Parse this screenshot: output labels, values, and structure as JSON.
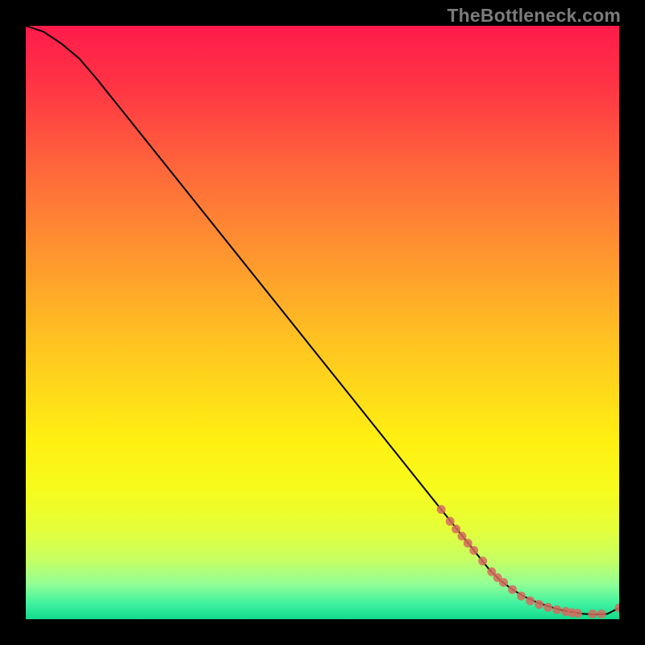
{
  "watermark": "TheBottleneck.com",
  "chart_data": {
    "type": "line",
    "title": "",
    "xlabel": "",
    "ylabel": "",
    "xlim": [
      0,
      100
    ],
    "ylim": [
      0,
      100
    ],
    "grid": false,
    "legend": false,
    "background_gradient_stops": [
      {
        "offset": 0.0,
        "color": "#ff1b4b"
      },
      {
        "offset": 0.1,
        "color": "#ff3445"
      },
      {
        "offset": 0.25,
        "color": "#ff6a3a"
      },
      {
        "offset": 0.4,
        "color": "#ff9a2e"
      },
      {
        "offset": 0.55,
        "color": "#ffc81f"
      },
      {
        "offset": 0.7,
        "color": "#fff012"
      },
      {
        "offset": 0.78,
        "color": "#f7fb1c"
      },
      {
        "offset": 0.85,
        "color": "#e4ff3a"
      },
      {
        "offset": 0.9,
        "color": "#c6ff63"
      },
      {
        "offset": 0.94,
        "color": "#93ff95"
      },
      {
        "offset": 0.975,
        "color": "#3cf1a0"
      },
      {
        "offset": 1.0,
        "color": "#14d98b"
      }
    ],
    "series": [
      {
        "name": "bottleneck-curve",
        "color": "#000000",
        "x": [
          0,
          3,
          6,
          9,
          12,
          16,
          24,
          32,
          40,
          48,
          56,
          64,
          70,
          74,
          78,
          80,
          82,
          84,
          86,
          88,
          90,
          92,
          94,
          96,
          98,
          100
        ],
        "values": [
          100,
          99,
          97,
          94.5,
          91,
          86,
          76,
          66,
          56,
          46,
          36,
          26,
          18.5,
          13.5,
          8.5,
          6.5,
          5.0,
          3.8,
          2.9,
          2.2,
          1.6,
          1.2,
          0.9,
          0.8,
          0.9,
          1.9
        ]
      }
    ],
    "markers": {
      "name": "highlight-points",
      "color": "#d66b5e",
      "radius": 5.5,
      "x": [
        70.0,
        71.5,
        72.5,
        73.5,
        74.5,
        75.5,
        77.0,
        78.5,
        79.5,
        80.5,
        82.0,
        83.5,
        85.0,
        86.5,
        88.0,
        89.5,
        91.0,
        92.0,
        93.0,
        95.5,
        97.0,
        100.0
      ],
      "values": [
        18.5,
        16.5,
        15.2,
        14.0,
        12.8,
        11.6,
        9.8,
        8.0,
        7.0,
        6.2,
        5.0,
        3.9,
        3.1,
        2.5,
        2.0,
        1.6,
        1.3,
        1.1,
        1.0,
        0.9,
        0.9,
        1.9
      ]
    }
  }
}
